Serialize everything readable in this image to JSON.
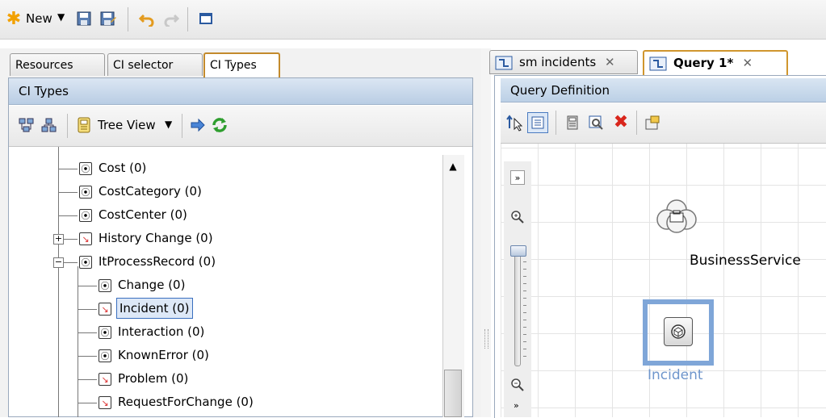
{
  "toolbar": {
    "new_label": "New",
    "new_icon": "asterisk-icon",
    "buttons": [
      "dropdown-arrow-icon",
      "save-icon",
      "save-as-icon",
      "undo-icon",
      "redo-icon",
      "window-icon"
    ]
  },
  "left_tabs": [
    "Resources",
    "CI selector",
    "CI Types"
  ],
  "left_active_tab": "CI Types",
  "left_panel": {
    "header": "CI Types",
    "view_label": "Tree View",
    "tree_items": [
      {
        "label": "Cost (0)",
        "icon": "ci-icon",
        "level": 1
      },
      {
        "label": "CostCategory (0)",
        "icon": "ci-icon",
        "level": 1
      },
      {
        "label": "CostCenter (0)",
        "icon": "ci-icon",
        "level": 1
      },
      {
        "label": "History Change (0)",
        "icon": "ci-broken-icon",
        "level": 1,
        "expander": "+"
      },
      {
        "label": "ItProcessRecord (0)",
        "icon": "ci-icon",
        "level": 1,
        "expander": "-"
      },
      {
        "label": "Change (0)",
        "icon": "ci-icon",
        "level": 2
      },
      {
        "label": "Incident (0)",
        "icon": "ci-broken-icon",
        "level": 2,
        "selected": true
      },
      {
        "label": "Interaction (0)",
        "icon": "ci-icon",
        "level": 2
      },
      {
        "label": "KnownError (0)",
        "icon": "ci-icon",
        "level": 2
      },
      {
        "label": "Problem (0)",
        "icon": "ci-broken-icon",
        "level": 2
      },
      {
        "label": "RequestForChange (0)",
        "icon": "ci-broken-icon",
        "level": 2
      }
    ]
  },
  "right_tabs": [
    {
      "label": "sm incidents",
      "active": false
    },
    {
      "label": "Query 1*",
      "active": true
    }
  ],
  "right_panel": {
    "header": "Query Definition",
    "nodes": {
      "business_service": "BusinessService",
      "incident": "Incident"
    }
  },
  "colors": {
    "selection": "#3a6fbf",
    "incident_highlight": "#7fa6d8",
    "active_tab_border": "#d0962e",
    "refresh_green": "#2e9e2e",
    "delete_red": "#d9261c",
    "new_star": "#f2a100"
  }
}
